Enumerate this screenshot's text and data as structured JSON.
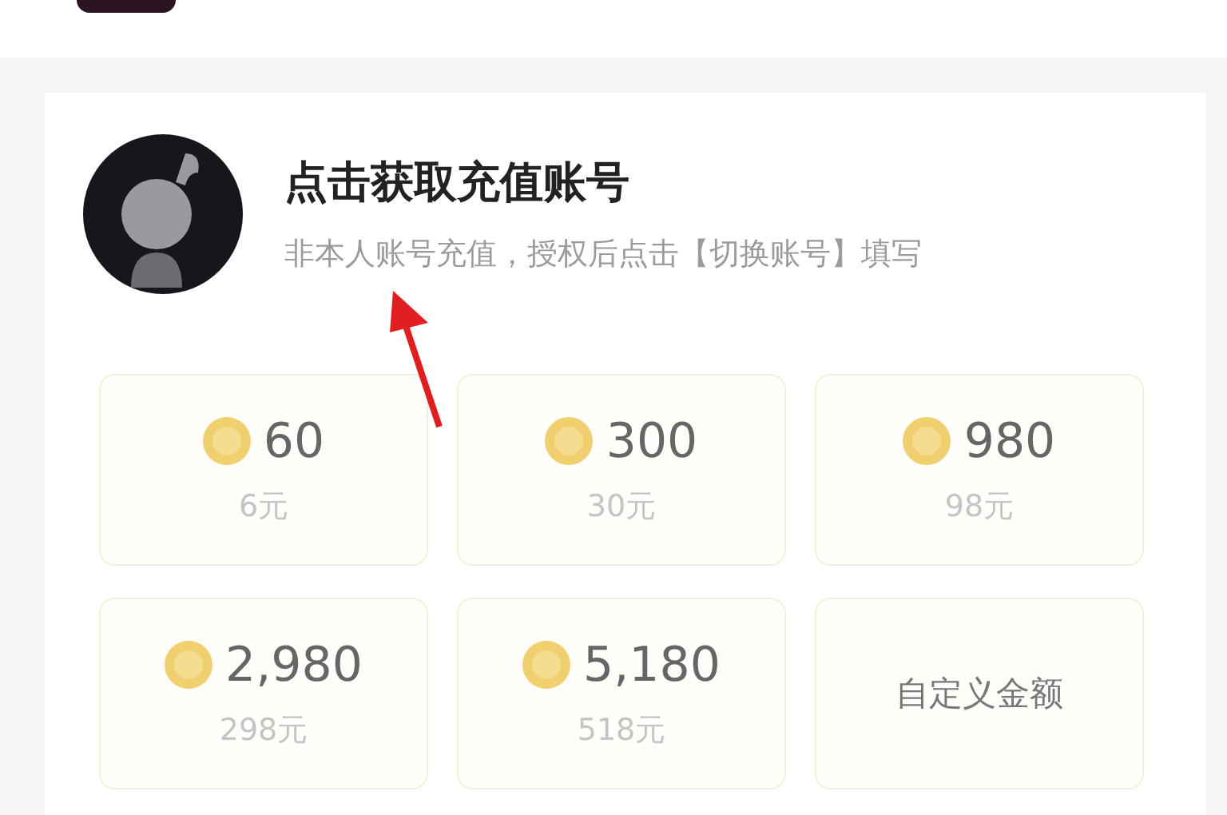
{
  "account": {
    "title": "点击获取充值账号",
    "subtitle": "非本人账号充值，授权后点击【切换账号】填写"
  },
  "options": [
    {
      "kind": "coins",
      "amount": "60",
      "price": "6元"
    },
    {
      "kind": "coins",
      "amount": "300",
      "price": "30元"
    },
    {
      "kind": "coins",
      "amount": "980",
      "price": "98元"
    },
    {
      "kind": "coins",
      "amount": "2,980",
      "price": "298元"
    },
    {
      "kind": "coins",
      "amount": "5,180",
      "price": "518元"
    },
    {
      "kind": "custom",
      "label": "自定义金额"
    }
  ]
}
